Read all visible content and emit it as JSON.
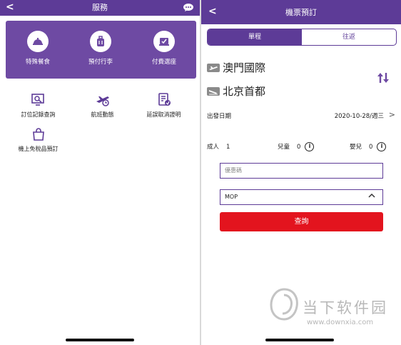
{
  "left": {
    "header": {
      "back_icon": "chevron-left-icon",
      "title": "服務",
      "chat_icon": "chat-bubble-icon"
    },
    "services": [
      {
        "label": "特殊餐食",
        "icon": "meal-cloche-icon"
      },
      {
        "label": "預付行李",
        "icon": "luggage-icon"
      },
      {
        "label": "付費選座",
        "icon": "seat-icon"
      }
    ],
    "tools": [
      {
        "label": "訂位記錄查詢",
        "icon": "booking-lookup-icon"
      },
      {
        "label": "航班動態",
        "icon": "flight-status-icon"
      },
      {
        "label": "延誤取消證明",
        "icon": "certificate-icon"
      },
      {
        "label": "機上免稅品預訂",
        "icon": "shopping-bag-icon"
      }
    ]
  },
  "right": {
    "header": {
      "back_icon": "chevron-left-icon",
      "title": "機票預訂"
    },
    "trip_type": {
      "one_way": "單程",
      "round_trip": "往返",
      "selected": "單程"
    },
    "origin": "澳門國際",
    "destination": "北京首都",
    "departure": {
      "label": "出發日期",
      "value": "2020-10-28/週三"
    },
    "passengers": [
      {
        "label": "成人",
        "count": "1"
      },
      {
        "label": "兒童",
        "count": "0"
      },
      {
        "label": "嬰兒",
        "count": "0"
      }
    ],
    "promo_placeholder": "優惠碼",
    "currency": "MOP",
    "search_label": "查詢"
  },
  "watermark": {
    "text": "当下软件园",
    "url": "www.downxia.com"
  },
  "colors": {
    "primary_purple": "#5d3b97",
    "card_purple": "#6e4aa3",
    "search_red": "#e3141e"
  }
}
